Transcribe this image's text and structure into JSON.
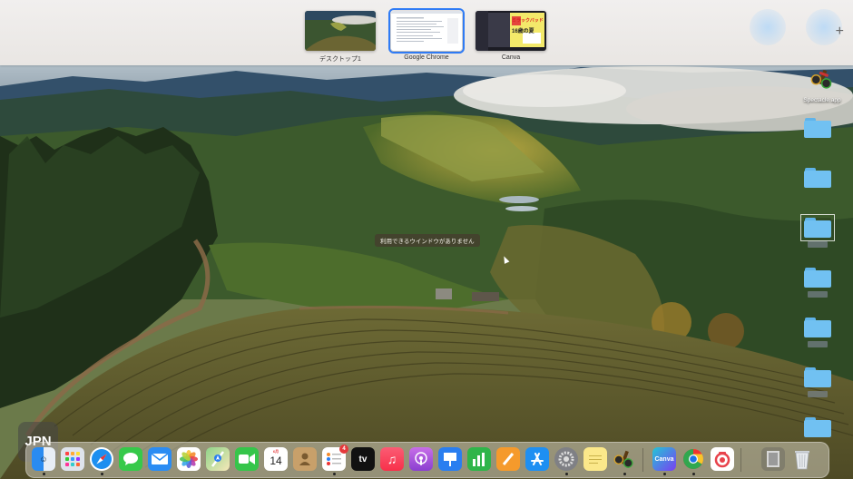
{
  "spaces": [
    {
      "label": "デスクトップ1",
      "active": false
    },
    {
      "label": "Google Chrome",
      "active": true
    },
    {
      "label": "Canva",
      "active": false
    }
  ],
  "add_space_symbol": "+",
  "center_message": "利用できるウインドウがありません",
  "desktop": {
    "app_label": "Spectacle.app",
    "folder_count": 7
  },
  "input_source": "JPN",
  "canva_thumb": {
    "line1": "ミラックバッド",
    "line2": "16歳の夏"
  },
  "dock": {
    "calendar_month": "6月",
    "calendar_day": "14",
    "reminders_badge": "4",
    "tv_label": "tv",
    "canva_label": "Canva",
    "items": [
      "finder-icon",
      "launchpad-icon",
      "safari-icon",
      "messages-icon",
      "mail-icon",
      "photos-icon",
      "maps-icon",
      "facetime-icon",
      "calendar-icon",
      "contacts-icon",
      "reminders-icon",
      "apple-tv-icon",
      "music-icon",
      "podcasts-icon",
      "keynote-icon",
      "numbers-icon",
      "pages-icon",
      "app-store-icon",
      "system-settings-icon",
      "notes-icon",
      "spectacle-icon",
      "canva-icon",
      "chrome-icon",
      "screen-recorder-icon",
      "downloads-icon",
      "trash-icon"
    ]
  },
  "colors": {
    "accent": "#2f7bf5",
    "folder": "#71c1f2"
  }
}
